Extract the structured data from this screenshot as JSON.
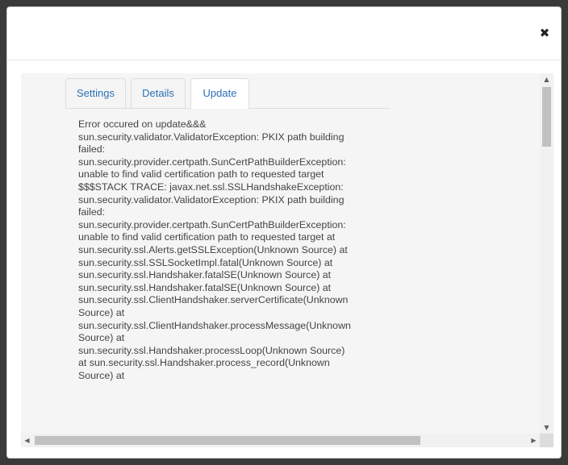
{
  "dialog": {
    "close_glyph": "✖",
    "close_icon": "close-icon"
  },
  "tabs": [
    {
      "label": "Settings",
      "active": false
    },
    {
      "label": "Details",
      "active": false
    },
    {
      "label": "Update",
      "active": true
    }
  ],
  "update": {
    "message": "Error occured on update&&&\nsun.security.validator.ValidatorException: PKIX path building\nfailed:\nsun.security.provider.certpath.SunCertPathBuilderException:\nunable to find valid certification path to requested target\n$$$STACK TRACE: javax.net.ssl.SSLHandshakeException:\nsun.security.validator.ValidatorException: PKIX path building\nfailed:\nsun.security.provider.certpath.SunCertPathBuilderException:\nunable to find valid certification path to requested target at\nsun.security.ssl.Alerts.getSSLException(Unknown Source) at\nsun.security.ssl.SSLSocketImpl.fatal(Unknown Source) at\nsun.security.ssl.Handshaker.fatalSE(Unknown Source) at\nsun.security.ssl.Handshaker.fatalSE(Unknown Source) at\nsun.security.ssl.ClientHandshaker.serverCertificate(Unknown\nSource) at\nsun.security.ssl.ClientHandshaker.processMessage(Unknown\nSource) at\nsun.security.ssl.Handshaker.processLoop(Unknown Source)\nat sun.security.ssl.Handshaker.process_record(Unknown\nSource) at"
  },
  "scrollbars": {
    "up_glyph": "▲",
    "down_glyph": "▼",
    "left_glyph": "◀",
    "right_glyph": "▶"
  },
  "colors": {
    "tab_text": "#2a6fb8",
    "panel_background": "#f5f5f5",
    "message_text": "#444444"
  }
}
